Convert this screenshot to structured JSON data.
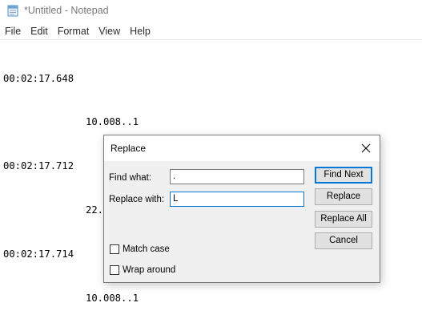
{
  "window": {
    "title": "*Untitled - Notepad",
    "icon": "notepad-icon"
  },
  "menu": {
    "items": [
      "File",
      "Edit",
      "Format",
      "View",
      "Help"
    ]
  },
  "editor": {
    "lines": [
      {
        "text": "00:02:17.648",
        "indent": false
      },
      {
        "text": "10.008..1",
        "indent": true
      },
      {
        "text": "00:02:17.712",
        "indent": false
      },
      {
        "text": "22.008..9",
        "indent": true
      },
      {
        "text": "00:02:17.714",
        "indent": false
      },
      {
        "text": "10.008..1",
        "indent": true
      }
    ]
  },
  "dialog": {
    "title": "Replace",
    "close_icon": "close-icon",
    "find_label": "Find what:",
    "find_value": ".",
    "replace_label": "Replace with:",
    "replace_value": "L",
    "buttons": {
      "find_next": "Find Next",
      "replace": "Replace",
      "replace_all": "Replace All",
      "cancel": "Cancel"
    },
    "match_case_label": "Match case",
    "match_case_checked": false,
    "wrap_around_label": "Wrap around",
    "wrap_around_checked": false
  },
  "colors": {
    "focus_accent": "#0078d7",
    "dialog_background": "#f0f0f0",
    "button_background": "#e1e1e1"
  }
}
